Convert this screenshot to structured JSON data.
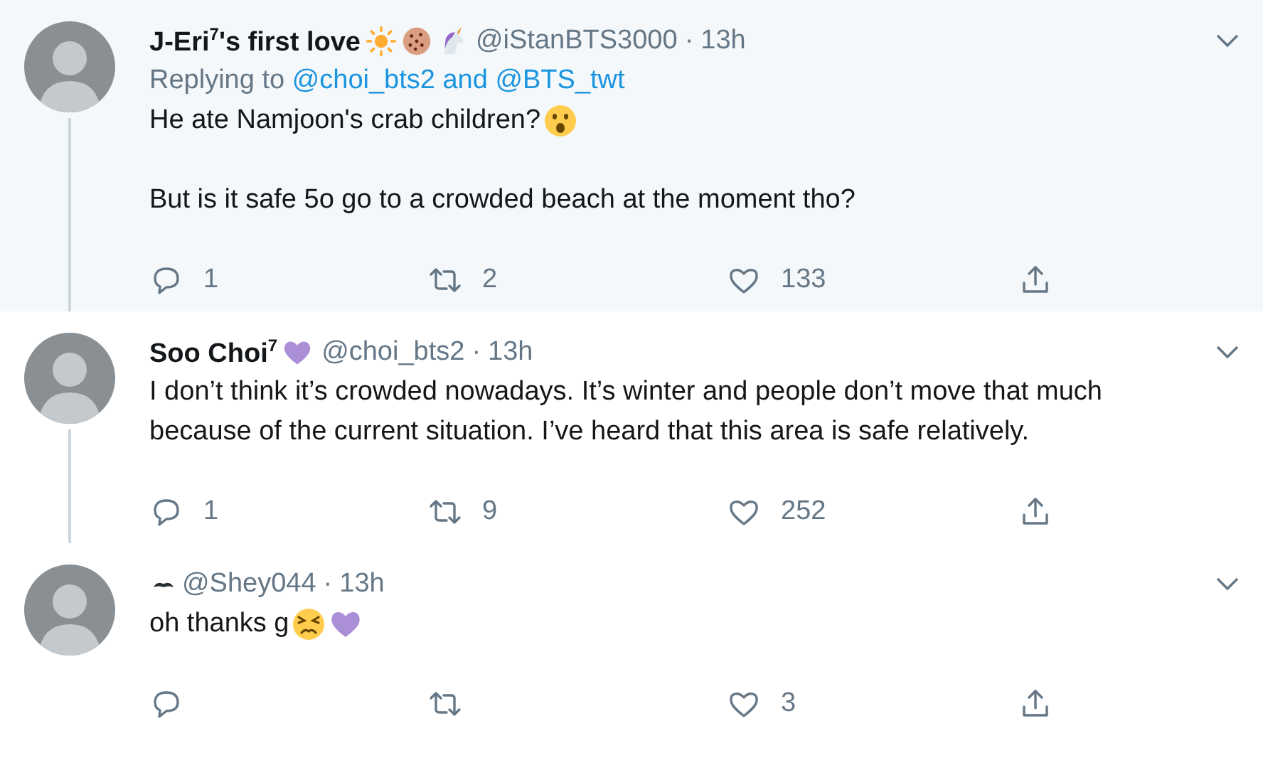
{
  "tweets": [
    {
      "display_name": "J-Eri$^{7}$'s first love",
      "name_badges": [
        {
          "kind": "sun"
        },
        {
          "kind": "cookie"
        },
        {
          "kind": "unicorn"
        }
      ],
      "handle": "@iStanBTS3000",
      "separator": "·",
      "time": "13h",
      "highlighted": true,
      "thread_below": true,
      "replying": {
        "label": "Replying to",
        "users": "@choi_bts2 and @BTS_twt"
      },
      "body": [
        {
          "text": "He ate Namjoon's crab children?",
          "emojis": [
            {
              "kind": "surprised"
            }
          ]
        },
        {
          "text": "But is it safe 5o go to a crowded beach at the moment tho?"
        }
      ],
      "replies": "1",
      "retweets": "2",
      "likes": "133"
    },
    {
      "display_name": "Soo Choi$^{7}$",
      "name_badges": [
        {
          "kind": "purple-heart"
        }
      ],
      "handle": "@choi_bts2",
      "separator": "·",
      "time": "13h",
      "highlighted": false,
      "thread_below": true,
      "body": [
        {
          "text": "I don’t think it’s crowded nowadays. It’s winter and people don’t move that much because of the current situation. I’ve heard that this area is safe relatively."
        }
      ],
      "replies": "1",
      "retweets": "9",
      "likes": "252"
    },
    {
      "name_badges": [
        {
          "kind": "mustache"
        }
      ],
      "handle": "@Shey044",
      "separator": "·",
      "time": "13h",
      "highlighted": false,
      "thread_below": false,
      "body": [
        {
          "text": "oh thanks g",
          "emojis": [
            {
              "kind": "persevering"
            },
            {
              "kind": "purple-heart"
            }
          ]
        }
      ],
      "likes": "3"
    }
  ]
}
